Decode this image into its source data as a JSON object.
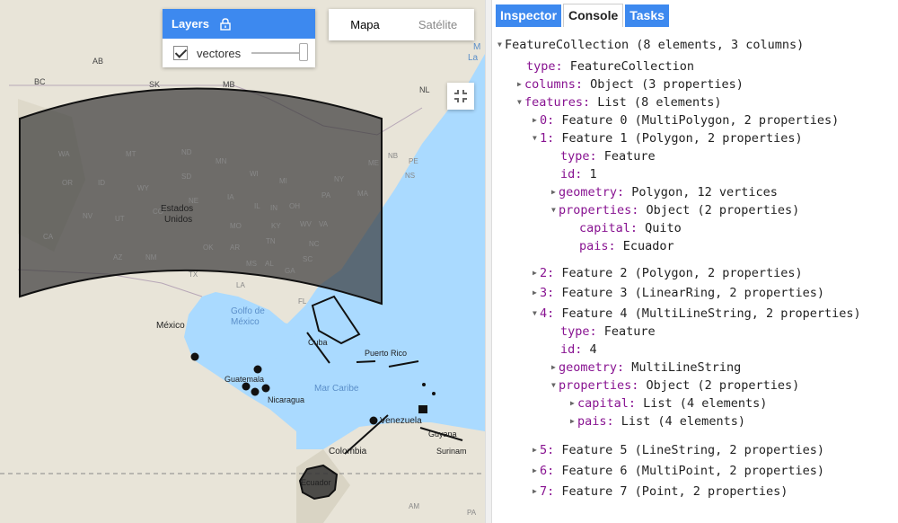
{
  "colors": {
    "tab_blue": "#3d89ef",
    "water": "#aadaff",
    "land": "#e8e4d8",
    "key_purple": "#881391",
    "overlay": "#333333"
  },
  "map": {
    "layers_panel": {
      "title": "Layers",
      "lock_icon": "lock-icon",
      "layer_name": "vectores",
      "layer_checked": true,
      "opacity": 1.0
    },
    "map_type": {
      "map_label": "Mapa",
      "satellite_label": "Satélite",
      "selected": "Mapa"
    },
    "fullscreen_icon": "fullscreen-exit-icon",
    "labels": {
      "ab": "AB",
      "bc": "BC",
      "sk": "SK",
      "mb": "MB",
      "nl": "NL",
      "la": "La",
      "m": "M",
      "wa": "WA",
      "mt": "MT",
      "nd": "ND",
      "or": "OR",
      "id": "ID",
      "sd": "SD",
      "wy": "WY",
      "mn": "MN",
      "wi": "WI",
      "ne": "NE",
      "ia": "IA",
      "nv": "NV",
      "ut": "UT",
      "co": "CO",
      "ca": "CA",
      "az": "AZ",
      "nm": "NM",
      "ok": "OK",
      "ar": "AR",
      "tx": "TX",
      "la_state": "LA",
      "ms": "MS",
      "al": "AL",
      "ga": "GA",
      "sc": "SC",
      "nc": "NC",
      "tn": "TN",
      "ky": "KY",
      "mo": "MO",
      "il": "IL",
      "in": "IN",
      "oh": "OH",
      "mi": "MI",
      "pa": "PA",
      "ny": "NY",
      "wv": "WV",
      "va": "VA",
      "me": "ME",
      "ma": "MA",
      "nb": "NB",
      "pe": "PE",
      "ns": "NS",
      "fl": "FL",
      "estados": "Estados",
      "unidos": "Unidos",
      "golfo1": "Golfo de",
      "golfo2": "México",
      "mexico": "México",
      "cuba": "Cuba",
      "puerto_rico": "Puerto Rico",
      "guatemala": "Guatemala",
      "nicaragua": "Nicaragua",
      "mar_caribe": "Mar Caribe",
      "venezuela": "Venezuela",
      "guyana": "Guyana",
      "surinam": "Surinam",
      "colombia": "Colombia",
      "ecuador": "Ecuador",
      "am": "AM",
      "pa_state": "PA"
    }
  },
  "tabs": [
    {
      "label": "Inspector",
      "active": false
    },
    {
      "label": "Console",
      "active": true
    },
    {
      "label": "Tasks",
      "active": false
    }
  ],
  "console": {
    "root": "FeatureCollection (8 elements, 3 columns)",
    "type_key": "type:",
    "type_val": "FeatureCollection",
    "columns_key": "columns:",
    "columns_val": "Object (3 properties)",
    "features_key": "features:",
    "features_val": "List (8 elements)",
    "f0_key": "0:",
    "f0_val": "Feature 0 (MultiPolygon, 2 properties)",
    "f1_key": "1:",
    "f1_val": "Feature 1 (Polygon, 2 properties)",
    "f1_type_key": "type:",
    "f1_type_val": "Feature",
    "f1_id_key": "id:",
    "f1_id_val": "1",
    "f1_geom_key": "geometry:",
    "f1_geom_val": "Polygon, 12 vertices",
    "f1_props_key": "properties:",
    "f1_props_val": "Object (2 properties)",
    "f1_capital_key": "capital:",
    "f1_capital_val": "Quito",
    "f1_pais_key": "pais:",
    "f1_pais_val": "Ecuador",
    "f2_key": "2:",
    "f2_val": "Feature 2 (Polygon, 2 properties)",
    "f3_key": "3:",
    "f3_val": "Feature 3 (LinearRing, 2 properties)",
    "f4_key": "4:",
    "f4_val": "Feature 4 (MultiLineString, 2 properties)",
    "f4_type_key": "type:",
    "f4_type_val": "Feature",
    "f4_id_key": "id:",
    "f4_id_val": "4",
    "f4_geom_key": "geometry:",
    "f4_geom_val": "MultiLineString",
    "f4_props_key": "properties:",
    "f4_props_val": "Object (2 properties)",
    "f4_capital_key": "capital:",
    "f4_capital_val": "List (4 elements)",
    "f4_pais_key": "pais:",
    "f4_pais_val": "List (4 elements)",
    "f5_key": "5:",
    "f5_val": "Feature 5 (LineString, 2 properties)",
    "f6_key": "6:",
    "f6_val": "Feature 6 (MultiPoint, 2 properties)",
    "f7_key": "7:",
    "f7_val": "Feature 7 (Point, 2 properties)"
  }
}
